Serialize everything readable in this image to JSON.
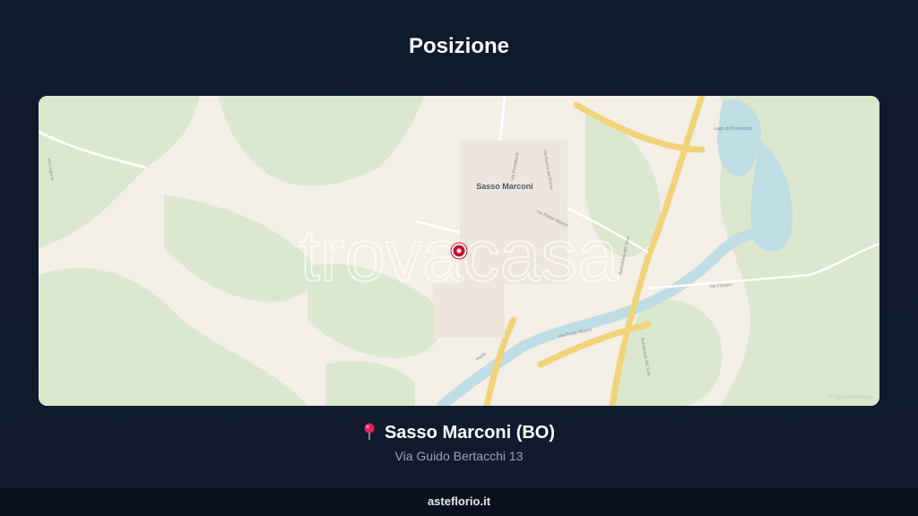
{
  "header": {
    "title": "Posizione"
  },
  "map": {
    "place_label": "Sasso Marconi",
    "lake_label": "Lago di Pontecchio",
    "watermark": "trovacasa",
    "attribution": "© OpenStreetMap",
    "river_label": "Reno",
    "roads": [
      "Via Porrettana",
      "Via Ponte Albano",
      "Via Vizzano",
      "Autostrada del Sole",
      "Via Lagune",
      "Via Nuova del Ponte"
    ],
    "pin_icon": "map-marker-icon",
    "colors": {
      "green": "#dbe8cf",
      "land": "#f3efe6",
      "water": "#bfdde5",
      "highway": "#f1d47a",
      "marker": "#c8102e"
    }
  },
  "location": {
    "pin_icon": "pushpin-icon",
    "name": "Sasso Marconi (BO)",
    "address": "Via Guido Bertacchi 13"
  },
  "footer": {
    "site": "asteflorio.it"
  }
}
